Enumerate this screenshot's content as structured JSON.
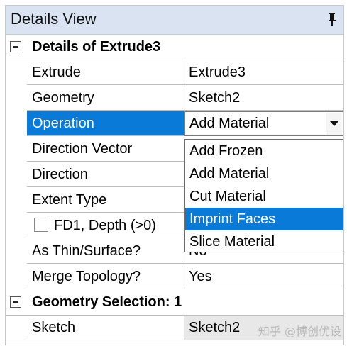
{
  "panel": {
    "title": "Details View"
  },
  "groups": [
    {
      "label": "Details of Extrude3"
    },
    {
      "label": "Geometry Selection: 1"
    }
  ],
  "rows": [
    {
      "name": "Extrude",
      "value": "Extrude3"
    },
    {
      "name": "Geometry",
      "value": "Sketch2"
    },
    {
      "name": "Operation",
      "value": "Add Material"
    },
    {
      "name": "Direction Vector",
      "value": ""
    },
    {
      "name": "Direction",
      "value": ""
    },
    {
      "name": "Extent Type",
      "value": ""
    },
    {
      "name": "FD1,  Depth (>0)",
      "value": ""
    },
    {
      "name": "As Thin/Surface?",
      "value": "No"
    },
    {
      "name": "Merge Topology?",
      "value": "Yes"
    },
    {
      "name": "Sketch",
      "value": "Sketch2"
    }
  ],
  "dropdown": {
    "options": [
      "Add Frozen",
      "Add Material",
      "Cut Material",
      "Imprint Faces",
      "Slice Material"
    ],
    "highlighted": "Imprint Faces"
  },
  "watermark": "知乎 @博创优设",
  "colors": {
    "selection": "#0a7ad8",
    "titlebar": "#d9e3f2"
  }
}
